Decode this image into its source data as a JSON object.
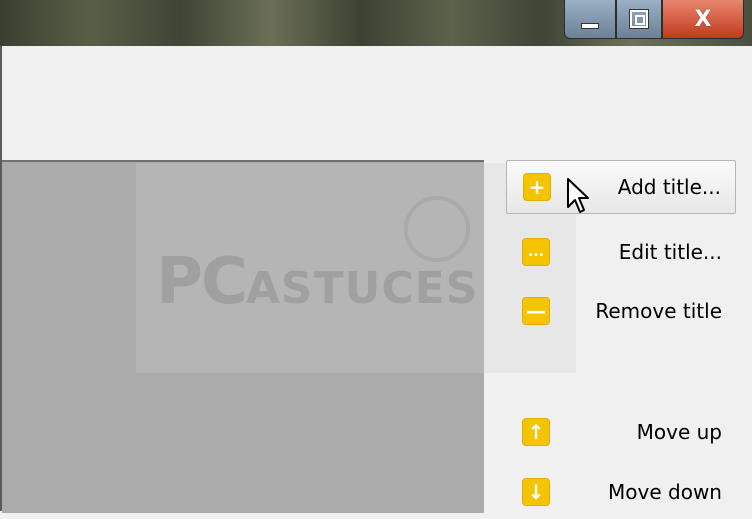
{
  "window": {
    "controls": {
      "minimize": "—",
      "maximize": "",
      "close": "X"
    }
  },
  "actions": [
    {
      "label": "Add title...",
      "icon": "plus-icon",
      "glyph": "+"
    },
    {
      "label": "Edit title...",
      "icon": "ellipsis-icon",
      "glyph": "..."
    },
    {
      "label": "Remove title",
      "icon": "minus-icon",
      "glyph": "—"
    },
    {
      "label": "Move up",
      "icon": "arrow-up-icon",
      "glyph": "↑"
    },
    {
      "label": "Move down",
      "icon": "arrow-down-icon",
      "glyph": "↓"
    }
  ],
  "colors": {
    "icon_yellow": "#f5c400",
    "panel_gray": "#ababab",
    "window_bg": "#f0f0f0"
  },
  "watermark": {
    "brand": "PC",
    "word": "ASTUCES"
  }
}
